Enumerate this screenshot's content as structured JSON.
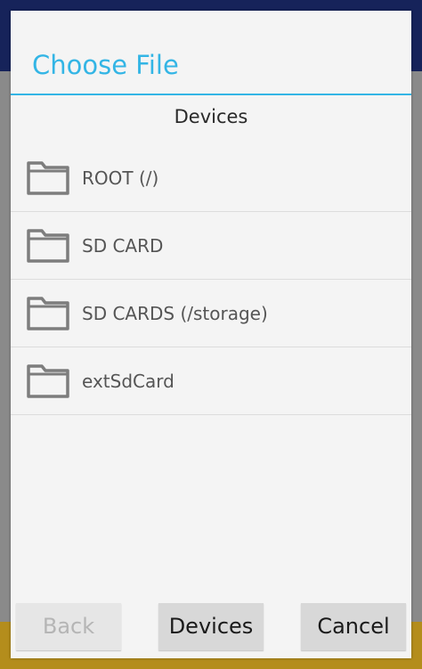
{
  "dialog": {
    "title": "Choose File",
    "section_header": "Devices",
    "items": [
      {
        "label": "ROOT (/)",
        "icon": "folder-icon"
      },
      {
        "label": "SD CARD",
        "icon": "folder-icon"
      },
      {
        "label": "SD CARDS (/storage)",
        "icon": "folder-icon"
      },
      {
        "label": "extSdCard",
        "icon": "folder-icon"
      }
    ],
    "buttons": {
      "back": "Back",
      "devices": "Devices",
      "cancel": "Cancel"
    }
  },
  "colors": {
    "accent": "#33b5e5",
    "folder_icon": "#7d7d7d",
    "dialog_background": "#f4f4f4"
  }
}
